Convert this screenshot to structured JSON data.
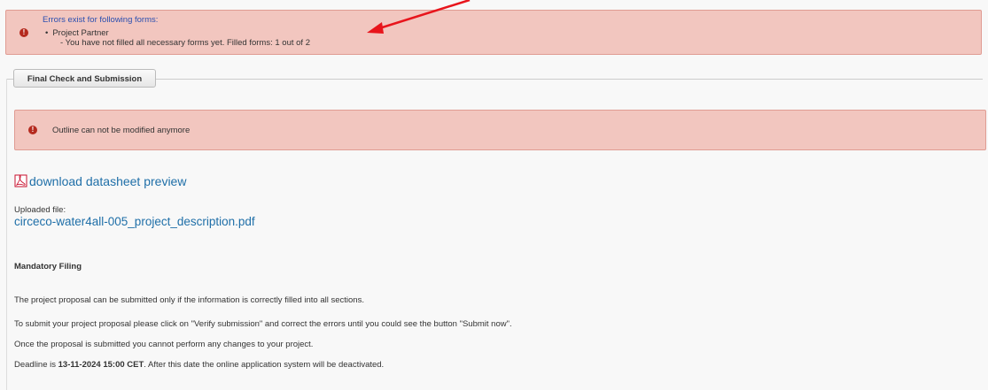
{
  "errors_top": {
    "title": "Errors exist for following forms:",
    "item": "Project Partner",
    "detail": "- You have not filled all necessary forms yet. Filled forms: 1 out of 2"
  },
  "section": {
    "legend": "Final Check and Submission"
  },
  "errors_mid": {
    "text": "Outline can not be modified anymore"
  },
  "download": {
    "label": "download datasheet preview"
  },
  "upload": {
    "label": "Uploaded file:",
    "filename": "circeco-water4all-005_project_description.pdf"
  },
  "mandatory": {
    "heading": "Mandatory Filing",
    "p1": "The project proposal can be submitted only if the information is correctly filled into all sections.",
    "p2": "To submit your project proposal please click on \"Verify submission\" and correct the errors until you could see the button \"Submit now\".",
    "p3": "Once the proposal is submitted you cannot perform any changes to your project.",
    "p4_prefix": "Deadline is ",
    "p4_date": "13-11-2024 15:00 CET",
    "p4_suffix": ". After this date the online application system will be deactivated."
  },
  "colors": {
    "error_bg": "#f2c6bf",
    "link": "#1f6fa8",
    "annotation_arrow": "#e8151c"
  }
}
